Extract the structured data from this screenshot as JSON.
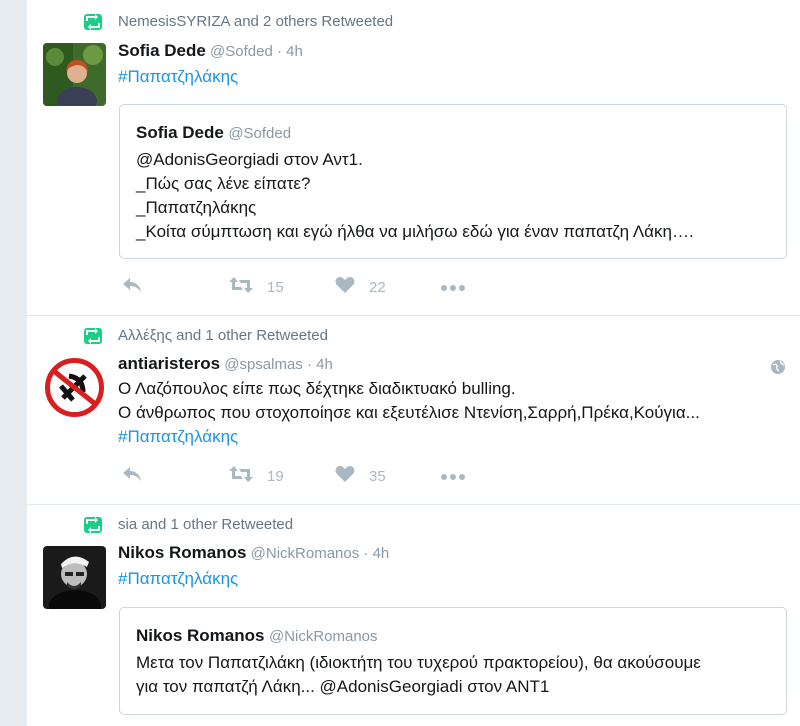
{
  "tweets": [
    {
      "retweet_context": "NemesisSYRIZA and 2 others Retweeted",
      "fullname": "Sofia Dede",
      "handle": "@Sofded",
      "time": "4h",
      "text_lines": [
        "#Παπατζηλάκης"
      ],
      "quote": {
        "fullname": "Sofia Dede",
        "handle": "@Sofded",
        "lines": [
          "@AdonisGeorgiadi στον Αντ1.",
          "_Πώς σας λένε είπατε?",
          "_Παπατζηλάκης",
          "_Κοίτα σύμπτωση και εγώ ήλθα να μιλήσω εδώ  για έναν παπατζη Λάκη…."
        ]
      },
      "retweets": "15",
      "likes": "22"
    },
    {
      "retweet_context": "Αλλέξης and 1 other Retweeted",
      "fullname": "antiaristeros",
      "handle": "@spsalmas",
      "time": "4h",
      "text_lines": [
        "Ο Λαζόπουλος είπε πως δέχτηκε διαδικτυακό bulling.",
        "Ο άνθρωπος που στοχοποίησε και εξευτέλισε Ντενίση,Σαρρή,Πρέκα,Κούγια...",
        "#Παπατζηλάκης"
      ],
      "retweets": "19",
      "likes": "35"
    },
    {
      "retweet_context": "sia and 1 other Retweeted",
      "fullname": "Nikos Romanos",
      "handle": "@NickRomanos",
      "time": "4h",
      "text_lines": [
        "#Παπατζηλάκης"
      ],
      "quote": {
        "fullname": "Nikos Romanos",
        "handle": "@NickRomanos",
        "lines": [
          "Μετα τον Παπατζιλάκη (ιδιοκτήτη του τυχερού πρακτορείου), θα ακούσουμε",
          "για τον παπατζή Λάκη... @AdonisGeorgiadi στον ΑΝΤ1"
        ]
      }
    }
  ],
  "separator": "·",
  "icons": {
    "retweet_badge": "retweet-icon",
    "reply": "reply-icon",
    "retweet": "retweet-icon",
    "like": "heart-icon",
    "more": "more-dots-icon",
    "globe": "globe-icon"
  },
  "colors": {
    "hashtag": "#1b95e0",
    "retweet_badge": "#19cf86",
    "action_gray": "#aab8c2",
    "meta_gray": "#657786"
  }
}
